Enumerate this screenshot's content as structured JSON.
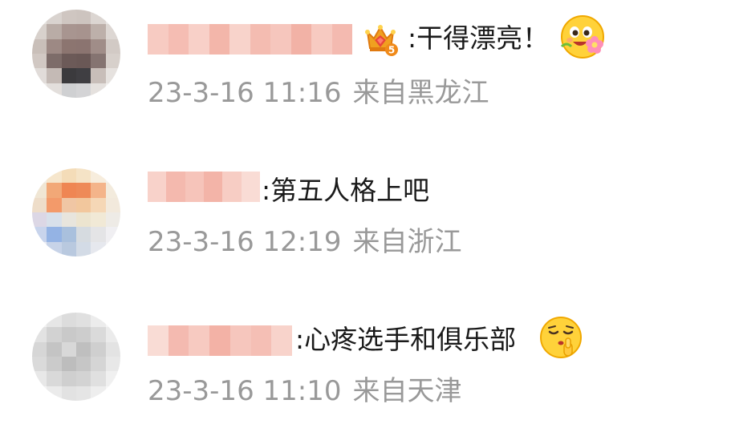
{
  "comments": [
    {
      "text": ":干得漂亮！",
      "time": "23-3-16 11:16",
      "location": "来自黑龙江",
      "badge": "crown-badge-icon",
      "emoji": "flower-smile-emoji-icon"
    },
    {
      "text": ":第五人格上吧",
      "time": "23-3-16 12:19",
      "location": "来自浙江"
    },
    {
      "text": ":心疼选手和俱乐部",
      "time": "23-3-16 11:10",
      "location": "来自天津",
      "emoji": "shush-emoji-icon"
    }
  ],
  "colors": {
    "text": "#1a1a1a",
    "meta": "#999999",
    "name_blur": "#f4b8ae"
  }
}
